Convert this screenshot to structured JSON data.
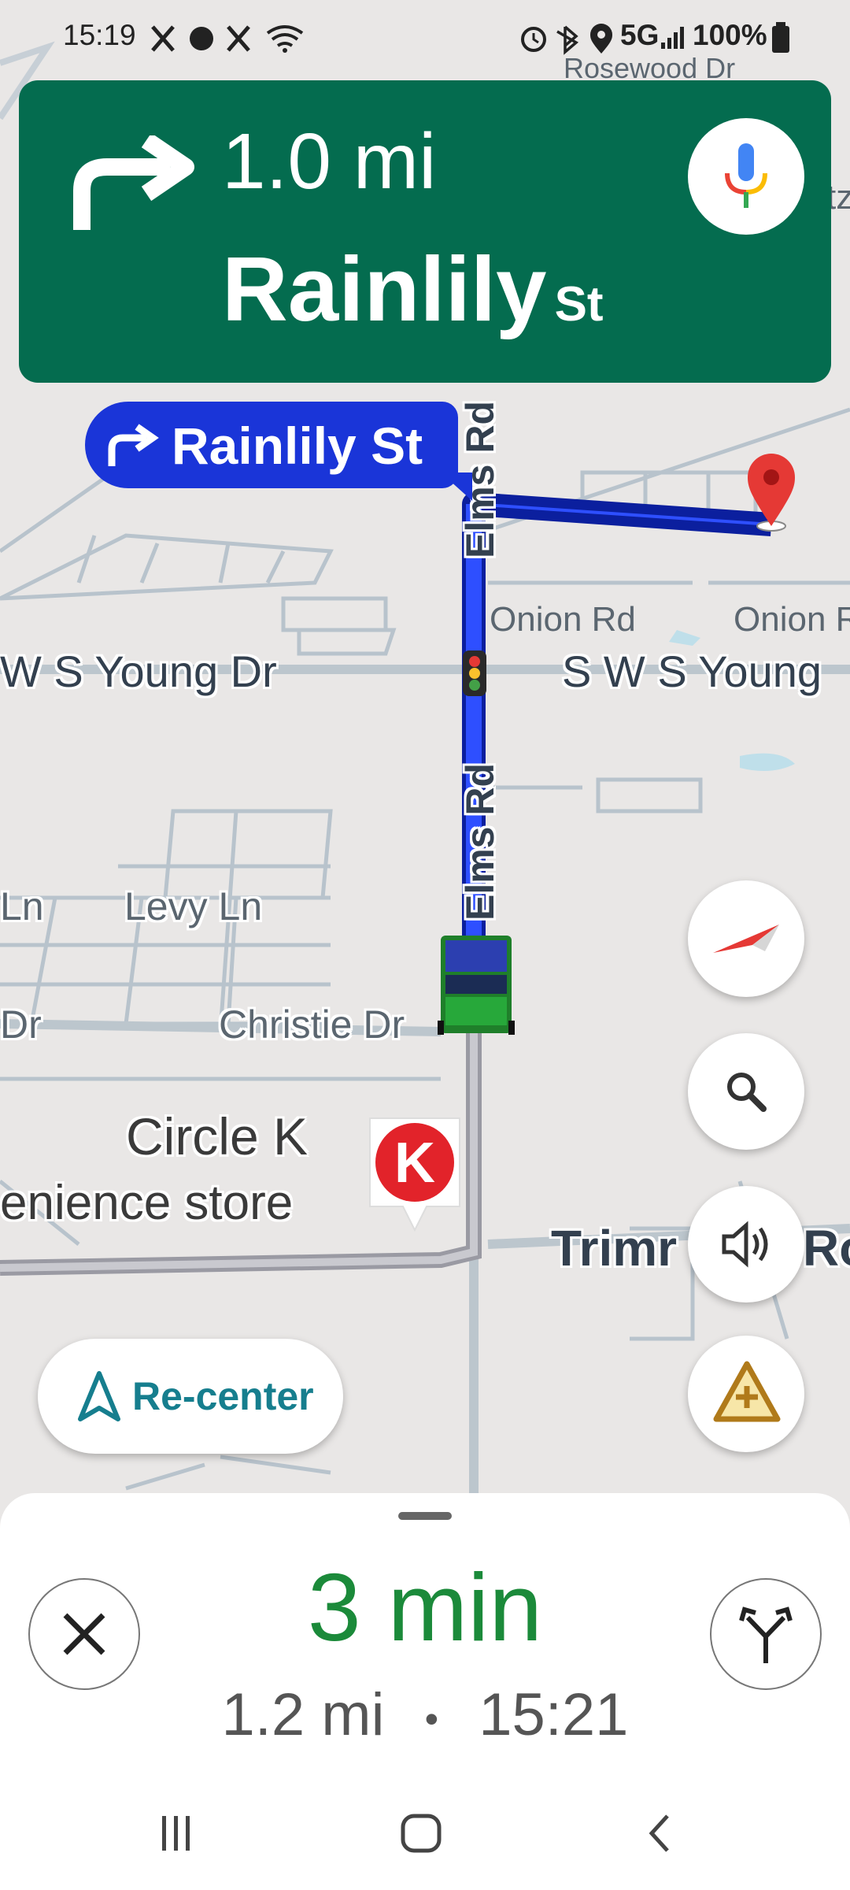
{
  "status_bar": {
    "time": "15:19",
    "left_icons": [
      "x-icon",
      "dot-icon",
      "x-icon",
      "wifi-icon"
    ],
    "network": "5G",
    "battery": "100%"
  },
  "navigation": {
    "turn_icon": "turn-right-icon",
    "distance": "1.0 mi",
    "street_name": "Rainlily",
    "street_suffix": "St",
    "voice_icon": "mic-icon",
    "next_turn_callout": "Rainlily St"
  },
  "map": {
    "labels": {
      "rosewood": "Rosewood Dr",
      "elms_top": "Elms Rd",
      "elms_mid": "Elms Rd",
      "onion1": "Onion Rd",
      "onion2": "Onion R",
      "young_left": "W S Young Dr",
      "young_right": "S W S Young",
      "levy_left": "Ln",
      "levy": "Levy Ln",
      "dr_left": "Dr",
      "christie": "Christie Dr",
      "circlek_name": "Circle K",
      "circlek_type": "enience store",
      "trimm_a": "Trimr",
      "trimm_b": "Ro",
      "tz": "tz"
    },
    "poi_letter": "K",
    "colors": {
      "route": "#1a35d8",
      "banner": "#046c4f",
      "eta": "#1b8a3a"
    }
  },
  "controls": {
    "compass_icon": "compass-icon",
    "search_icon": "search-icon",
    "sound_icon": "volume-icon",
    "report_icon": "report-incident-icon",
    "recenter_label": "Re-center"
  },
  "trip": {
    "eta_minutes": "3 min",
    "remaining_distance": "1.2 mi",
    "separator": "•",
    "arrival_time": "15:21",
    "close_icon": "close-icon",
    "alternates_icon": "route-options-icon"
  },
  "system_nav": {
    "recents": "recents-icon",
    "home": "home-icon",
    "back": "back-icon"
  }
}
